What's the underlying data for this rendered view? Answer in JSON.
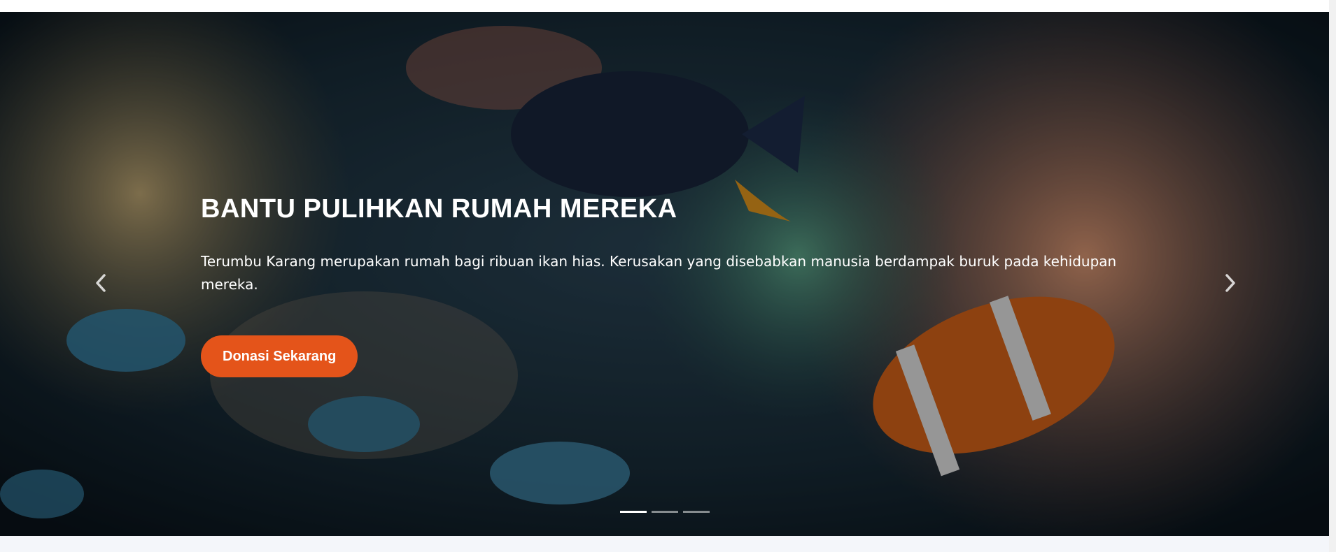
{
  "hero": {
    "title": "BANTU PULIHKAN RUMAH MEREKA",
    "description": "Terumbu Karang merupakan rumah bagi ribuan ikan hias. Kerusakan yang disebabkan manusia berdampak buruk pada kehidupan mereka.",
    "cta_label": "Donasi Sekarang",
    "cta_color": "#e4541a",
    "background": "underwater coral reef with clownfish and tropical fish"
  },
  "carousel": {
    "prev_icon": "chevron-left-icon",
    "next_icon": "chevron-right-icon",
    "slide_count": 3,
    "active_index": 0
  }
}
